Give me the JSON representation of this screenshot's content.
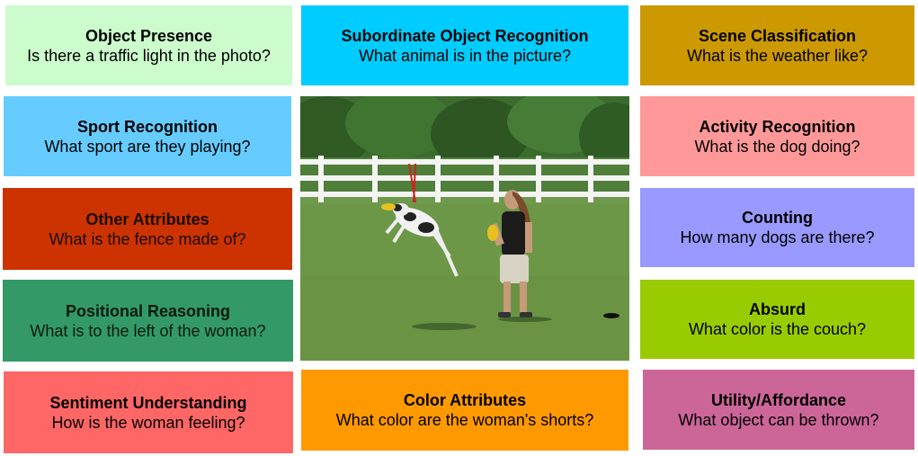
{
  "colors": {
    "object_presence": "#ccfccc",
    "subordinate_object_recognition": "#00ccff",
    "scene_classification": "#cc9900",
    "sport_recognition": "#66ccff",
    "activity_recognition": "#ff9999",
    "other_attributes": "#cc3300",
    "counting": "#9999ff",
    "positional_reasoning": "#339966",
    "absurd": "#99cc00",
    "sentiment_understanding": "#ff6666",
    "color_attributes": "#ff9900",
    "utility_affordance": "#cc6699"
  },
  "cards": [
    {
      "title": "Object Presence",
      "question": "Is there a traffic light in the photo?"
    },
    {
      "title": "Subordinate Object Recognition",
      "question": "What animal is in the picture?"
    },
    {
      "title": "Scene Classification",
      "question": "What is the weather like?"
    },
    {
      "title": "Sport Recognition",
      "question": "What sport are they playing?"
    },
    {
      "title": "Activity Recognition",
      "question": "What is the dog doing?"
    },
    {
      "title": "Other Attributes",
      "question": "What is the fence made of?"
    },
    {
      "title": "Counting",
      "question": "How many dogs are there?"
    },
    {
      "title": "Positional Reasoning",
      "question": "What is to the left of the woman?"
    },
    {
      "title": "Absurd",
      "question": "What color is the couch?"
    },
    {
      "title": "Sentiment Understanding",
      "question": "How is the woman feeling?"
    },
    {
      "title": "Color Attributes",
      "question": "What color are the woman's shorts?"
    },
    {
      "title": "Utility/Affordance",
      "question": "What object can be thrown?"
    }
  ]
}
